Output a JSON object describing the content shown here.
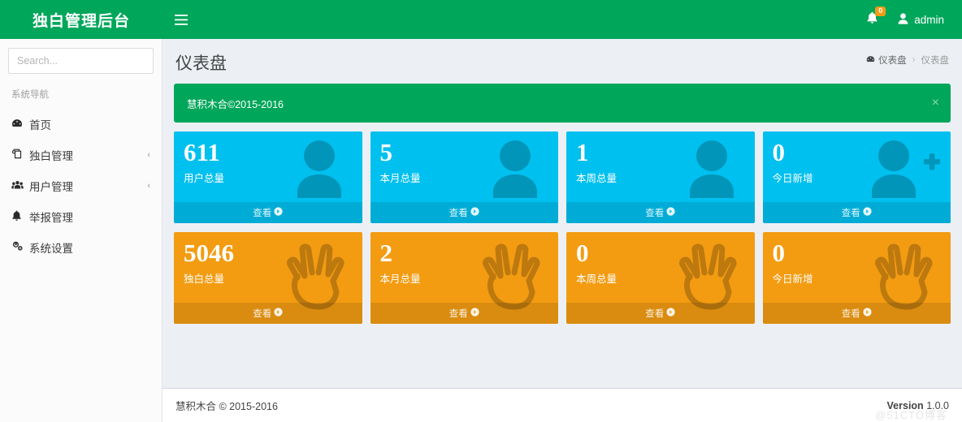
{
  "navbar": {
    "brand": "独白管理后台",
    "toggle_icon": "hamburger-icon",
    "notification_count": "0",
    "user_name": "admin"
  },
  "sidebar": {
    "search_placeholder": "Search...",
    "nav_header": "系统导航",
    "items": [
      {
        "label": "首页",
        "icon": "dashboard-icon",
        "arrow": ""
      },
      {
        "label": "独白管理",
        "icon": "book-icon",
        "arrow": "‹"
      },
      {
        "label": "用户管理",
        "icon": "users-icon",
        "arrow": "‹"
      },
      {
        "label": "举报管理",
        "icon": "bell-icon",
        "arrow": ""
      },
      {
        "label": "系统设置",
        "icon": "gears-icon",
        "arrow": ""
      }
    ]
  },
  "content": {
    "page_title": "仪表盘",
    "breadcrumb": {
      "home_label": "仪表盘",
      "separator": "›",
      "current_label": "仪表盘"
    },
    "alert": {
      "message": "慧积木合©2015-2016",
      "close_label": "×"
    },
    "cards": [
      {
        "number": "611",
        "text": "用户总量",
        "footer": "查看",
        "color": "aqua",
        "icon": "user-icon"
      },
      {
        "number": "5",
        "text": "本月总量",
        "footer": "查看",
        "color": "aqua",
        "icon": "user-icon"
      },
      {
        "number": "1",
        "text": "本周总量",
        "footer": "查看",
        "color": "aqua",
        "icon": "user-icon"
      },
      {
        "number": "0",
        "text": "今日新增",
        "footer": "查看",
        "color": "aqua",
        "icon": "user-plus-icon"
      },
      {
        "number": "5046",
        "text": "独白总量",
        "footer": "查看",
        "color": "orange",
        "icon": "hand-spock-icon"
      },
      {
        "number": "2",
        "text": "本月总量",
        "footer": "查看",
        "color": "orange",
        "icon": "hand-spock-icon"
      },
      {
        "number": "0",
        "text": "本周总量",
        "footer": "查看",
        "color": "orange",
        "icon": "hand-spock-icon"
      },
      {
        "number": "0",
        "text": "今日新增",
        "footer": "查看",
        "color": "orange",
        "icon": "hand-spock-icon"
      }
    ]
  },
  "footer": {
    "copyright": "慧积木合 © 2015-2016",
    "version_label": "Version",
    "version_value": "1.0.0",
    "watermark": "@51CTO博客"
  },
  "colors": {
    "brand_green": "#00a65a",
    "card_aqua": "#00c0ef",
    "card_orange": "#f39c12",
    "badge_orange": "#f39c12",
    "page_bg": "#ecf0f5",
    "sidebar_bg": "#fbfbfb"
  }
}
